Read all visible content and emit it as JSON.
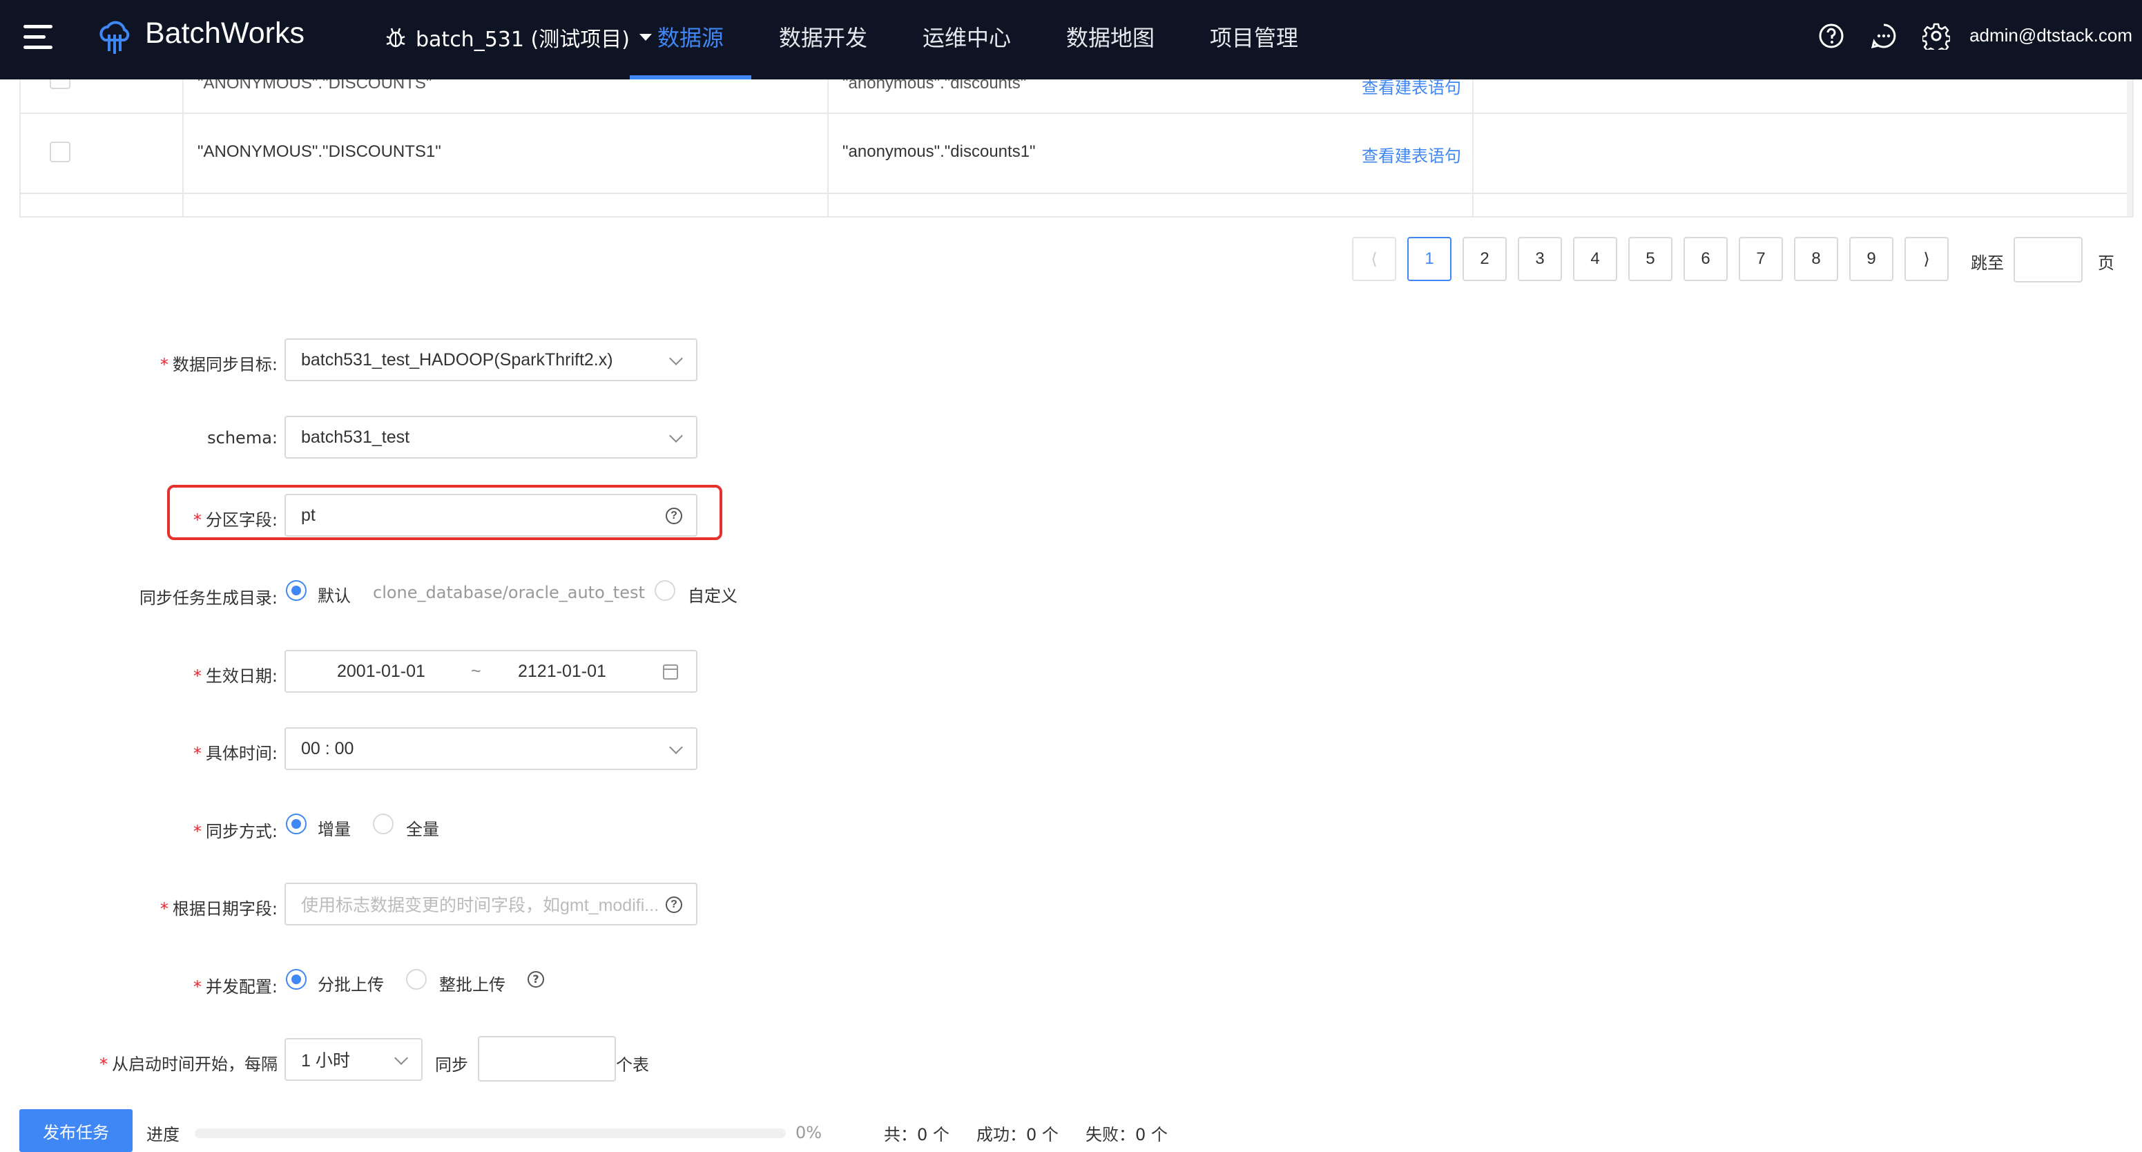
{
  "header": {
    "brand": "BatchWorks",
    "project": "batch_531 (测试项目)",
    "nav": [
      "数据源",
      "数据开发",
      "运维中心",
      "数据地图",
      "项目管理"
    ],
    "active_nav": "数据源",
    "user": "admin@dtstack.com",
    "icons": [
      "help-icon",
      "message-icon",
      "settings-icon"
    ]
  },
  "table": {
    "rows": [
      {
        "source": "\"ANONYMOUS\".\"DISCOUNTS\"",
        "target": "\"anonymous\".\"discounts\"",
        "action": "查看建表语句"
      },
      {
        "source": "\"ANONYMOUS\".\"DISCOUNTS1\"",
        "target": "\"anonymous\".\"discounts1\"",
        "action": "查看建表语句"
      }
    ]
  },
  "pagination": {
    "pages": [
      "1",
      "2",
      "3",
      "4",
      "5",
      "6",
      "7",
      "8",
      "9"
    ],
    "current": "1",
    "jump_label": "跳至",
    "page_suffix": "页"
  },
  "form": {
    "target": {
      "label": "数据同步目标",
      "value": "batch531_test_HADOOP(SparkThrift2.x)"
    },
    "schema": {
      "label": "schema",
      "value": "batch531_test"
    },
    "partition": {
      "label": "分区字段",
      "value": "pt"
    },
    "dir": {
      "label": "同步任务生成目录",
      "default_label": "默认",
      "default_path": "clone_database/oracle_auto_test",
      "custom_label": "自定义"
    },
    "date": {
      "label": "生效日期",
      "start": "2001-01-01",
      "sep": "~",
      "end": "2121-01-01"
    },
    "time": {
      "label": "具体时间",
      "value": "00 : 00"
    },
    "mode": {
      "label": "同步方式",
      "opt1": "增量",
      "opt2": "全量"
    },
    "date_field": {
      "label": "根据日期字段",
      "placeholder": "使用标志数据变更的时间字段，如gmt_modifi..."
    },
    "concurrency": {
      "label": "并发配置",
      "opt1": "分批上传",
      "opt2": "整批上传"
    },
    "interval": {
      "label": "从启动时间开始，每隔",
      "value": "1 小时",
      "sync_label": "同步",
      "unit": "个表"
    }
  },
  "footer": {
    "publish": "发布任务",
    "progress_label": "进度",
    "progress_value": 0,
    "progress_text": "0%",
    "total": "共：0 个",
    "success": "成功：0 个",
    "fail": "失败：0 个"
  },
  "colors": {
    "accent": "#3f87f5",
    "nav_bg": "#0f1424",
    "required": "#f5222d",
    "highlight": "#e5302b"
  }
}
